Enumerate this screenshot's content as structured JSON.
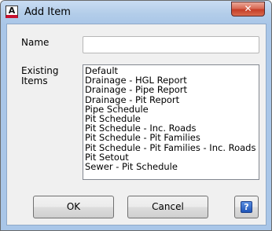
{
  "window": {
    "title": "Add Item",
    "app_icon_glyph": "A",
    "close_glyph": "✕"
  },
  "form": {
    "name_label": "Name",
    "name_value": "",
    "existing_label_line1": "Existing",
    "existing_label_line2": "Items",
    "existing_items": [
      "Default",
      "Drainage - HGL Report",
      "Drainage - Pipe Report",
      "Drainage - Pit Report",
      "Pipe Schedule",
      "Pit Schedule",
      "Pit Schedule - Inc. Roads",
      "Pit Schedule - Pit Families",
      "Pit Schedule - Pit Families - Inc. Roads",
      "Pit Setout",
      "Sewer - Pit Schedule"
    ]
  },
  "buttons": {
    "ok_label": "OK",
    "cancel_label": "Cancel",
    "help_glyph": "?"
  },
  "icons": {
    "app": "autocad-app-icon",
    "close": "close-icon",
    "help": "help-icon"
  },
  "colors": {
    "titlebar": "#b3cde9",
    "dialog_bg": "#f0f0f0",
    "close_button": "#c43b24",
    "help_icon": "#1f55b8"
  }
}
